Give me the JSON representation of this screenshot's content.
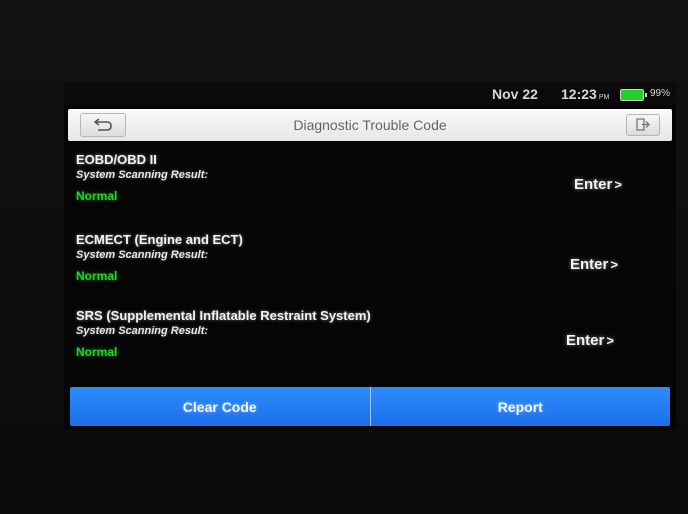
{
  "status_bar": {
    "date": "Nov 22",
    "time": "12:23",
    "ampm": "PM",
    "battery_percent_label": "99%",
    "battery_level": 0.99,
    "battery_color": "#24d12a"
  },
  "header": {
    "title": "Diagnostic Trouble Code",
    "back_icon": "back-arrow-icon",
    "exit_icon": "exit-icon"
  },
  "systems": [
    {
      "name": "EOBD/OBD II",
      "result_label": "System Scanning Result:",
      "result": "Normal",
      "enter_label": "Enter"
    },
    {
      "name": "ECMECT (Engine and ECT)",
      "result_label": "System Scanning Result:",
      "result": "Normal",
      "enter_label": "Enter"
    },
    {
      "name": "SRS (Supplemental Inflatable Restraint System)",
      "result_label": "System Scanning Result:",
      "result": "Normal",
      "enter_label": "Enter"
    }
  ],
  "footer": {
    "clear_code_label": "Clear Code",
    "report_label": "Report",
    "accent_color": "#1f7af0"
  },
  "colors": {
    "normal_status": "#22d42a",
    "screen_background": "#050505"
  }
}
